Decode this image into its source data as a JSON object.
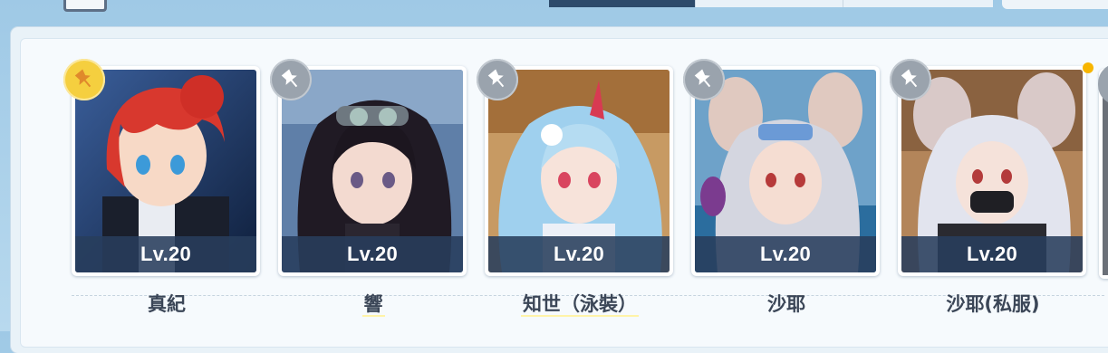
{
  "colors": {
    "accent_dark": "#2d4a6b",
    "pin_active": "#f5cf3f",
    "pin_inactive": "#9aa3ad",
    "level_bar": "#283e5c",
    "notify": "#f7b500"
  },
  "cards": [
    {
      "level": "Lv.20",
      "name": "真紀",
      "pinned": true,
      "icon": "pin-icon",
      "name_underlined": false
    },
    {
      "level": "Lv.20",
      "name": "響",
      "pinned": false,
      "icon": "pin-icon",
      "name_underlined": true
    },
    {
      "level": "Lv.20",
      "name": "知世（泳裝）",
      "pinned": false,
      "icon": "pin-icon",
      "name_underlined": true
    },
    {
      "level": "Lv.20",
      "name": "沙耶",
      "pinned": false,
      "icon": "pin-icon",
      "name_underlined": false
    },
    {
      "level": "Lv.20",
      "name": "沙耶(私服)",
      "pinned": false,
      "icon": "pin-icon",
      "name_underlined": false,
      "notify": true
    }
  ]
}
